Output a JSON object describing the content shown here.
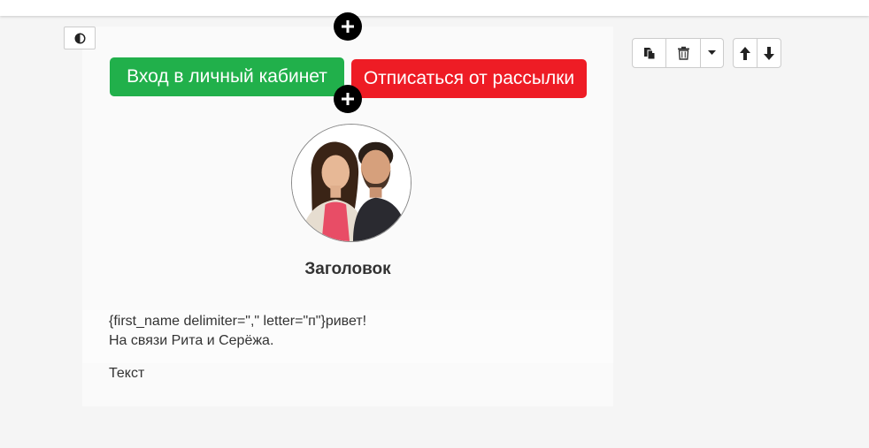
{
  "colors": {
    "login_button": "#21b04b",
    "unsubscribe_button": "#ee1c25",
    "add_control": "#000000"
  },
  "icons": {
    "contrast": "contrast-icon",
    "add": "plus-icon",
    "copy": "copy-icon",
    "delete": "trash-icon",
    "dropdown": "caret-down-icon",
    "move_up": "arrow-up-icon",
    "move_down": "arrow-down-icon"
  },
  "buttons": {
    "login_label": "Вход в личный кабинет",
    "unsubscribe_label": "Отписаться от рассылки"
  },
  "content": {
    "heading": "Заголовок",
    "greeting_line": "{first_name delimiter=\",\" letter=\"п\"}ривет!",
    "intro_line": "На связи Рита и Серёжа.",
    "body_text": "Текст"
  }
}
